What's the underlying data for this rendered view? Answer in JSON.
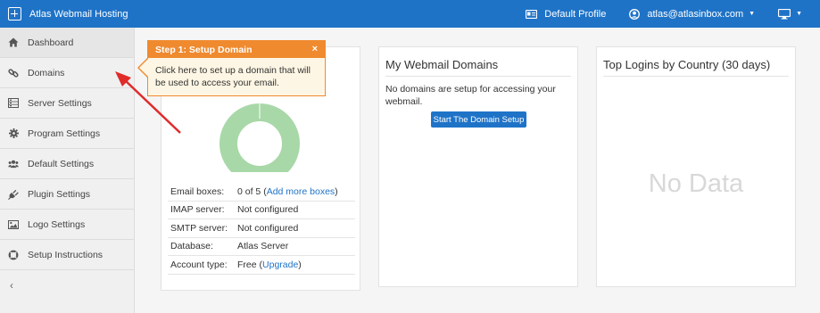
{
  "app": {
    "title": "Atlas Webmail Hosting"
  },
  "topbar": {
    "profile_label": "Default Profile",
    "user_email": "atlas@atlasinbox.com"
  },
  "sidebar": {
    "items": [
      {
        "label": "Dashboard",
        "icon": "home-icon"
      },
      {
        "label": "Domains",
        "icon": "link-icon"
      },
      {
        "label": "Server Settings",
        "icon": "server-icon"
      },
      {
        "label": "Program Settings",
        "icon": "gear-icon"
      },
      {
        "label": "Default Settings",
        "icon": "users-icon"
      },
      {
        "label": "Plugin Settings",
        "icon": "plug-icon"
      },
      {
        "label": "Logo Settings",
        "icon": "image-icon"
      },
      {
        "label": "Setup Instructions",
        "icon": "lifebuoy-icon"
      }
    ],
    "collapse_glyph": "‹"
  },
  "tooltip": {
    "title": "Step 1: Setup Domain",
    "close": "×",
    "body": "Click here to set up a domain that will be used to access your email."
  },
  "account_panel": {
    "donut_used": 0,
    "donut_total": 5,
    "rows": [
      {
        "label": "Email boxes:",
        "value": "0 of 5",
        "link": "Add more boxes"
      },
      {
        "label": "IMAP server:",
        "value": "Not configured"
      },
      {
        "label": "SMTP server:",
        "value": "Not configured"
      },
      {
        "label": "Database:",
        "value": "Atlas Server"
      },
      {
        "label": "Account type:",
        "value": "Free",
        "link": "Upgrade"
      }
    ]
  },
  "domains_panel": {
    "title": "My Webmail Domains",
    "message": "No domains are setup for accessing your webmail.",
    "button_label": "Start The Domain Setup"
  },
  "logins_panel": {
    "title": "Top Logins by Country (30 days)",
    "empty_text": "No Data"
  },
  "colors": {
    "brand": "#1f73c7",
    "tooltip_accent": "#ef8a2e",
    "donut": "#a8d8a8",
    "arrow": "#e02b2b"
  }
}
